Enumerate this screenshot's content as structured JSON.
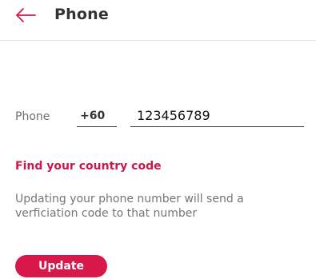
{
  "header": {
    "title": "Phone",
    "back_icon": "arrow-left-icon"
  },
  "form": {
    "phone_label": "Phone",
    "country_code": "+60",
    "phone_number": "123456789"
  },
  "links": {
    "find_country_code": "Find your country code"
  },
  "info": {
    "message": "Updating your phone number will send a verficiation code to that number"
  },
  "actions": {
    "update_label": "Update"
  },
  "colors": {
    "accent": "#d8174b",
    "link": "#c9184a",
    "muted_text": "#757575"
  }
}
